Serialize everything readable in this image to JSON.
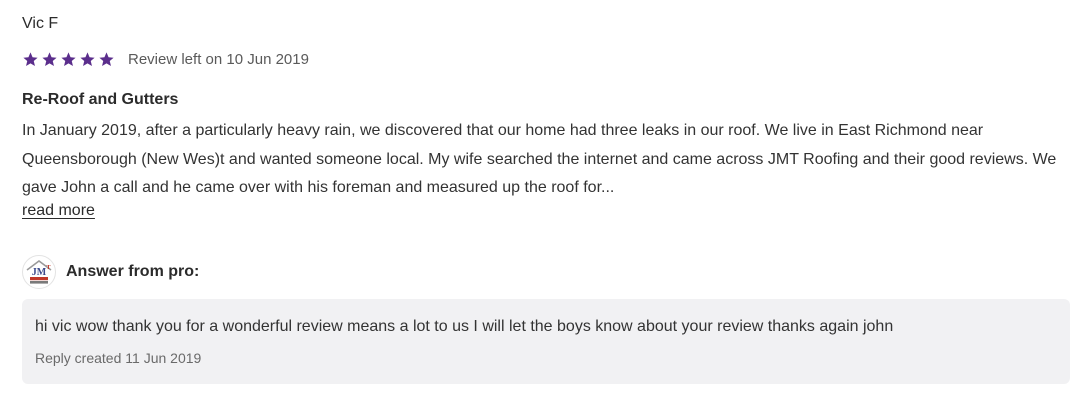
{
  "review": {
    "reviewer_name": "Vic F",
    "rating": 5,
    "rating_max": 5,
    "star_color": "#5b2e8c",
    "date_text": "Review left on 10 Jun 2019",
    "title": "Re-Roof and Gutters",
    "body": "In January 2019, after a particularly heavy rain, we discovered that our home had three leaks in our roof. We live in East Richmond near Queensborough (New Wes)t and wanted someone local. My wife searched the internet and came across JMT Roofing and their good reviews. We gave John a call and he came over with his foreman and measured up the roof for...",
    "read_more_label": "read more"
  },
  "answer": {
    "label": "Answer from pro:",
    "logo_icon": "jmt-roofing-logo",
    "reply_text": "hi vic wow thank you for a wonderful review means a lot to us I will let the boys know about your review thanks again john",
    "reply_date": "Reply created 11 Jun 2019"
  }
}
